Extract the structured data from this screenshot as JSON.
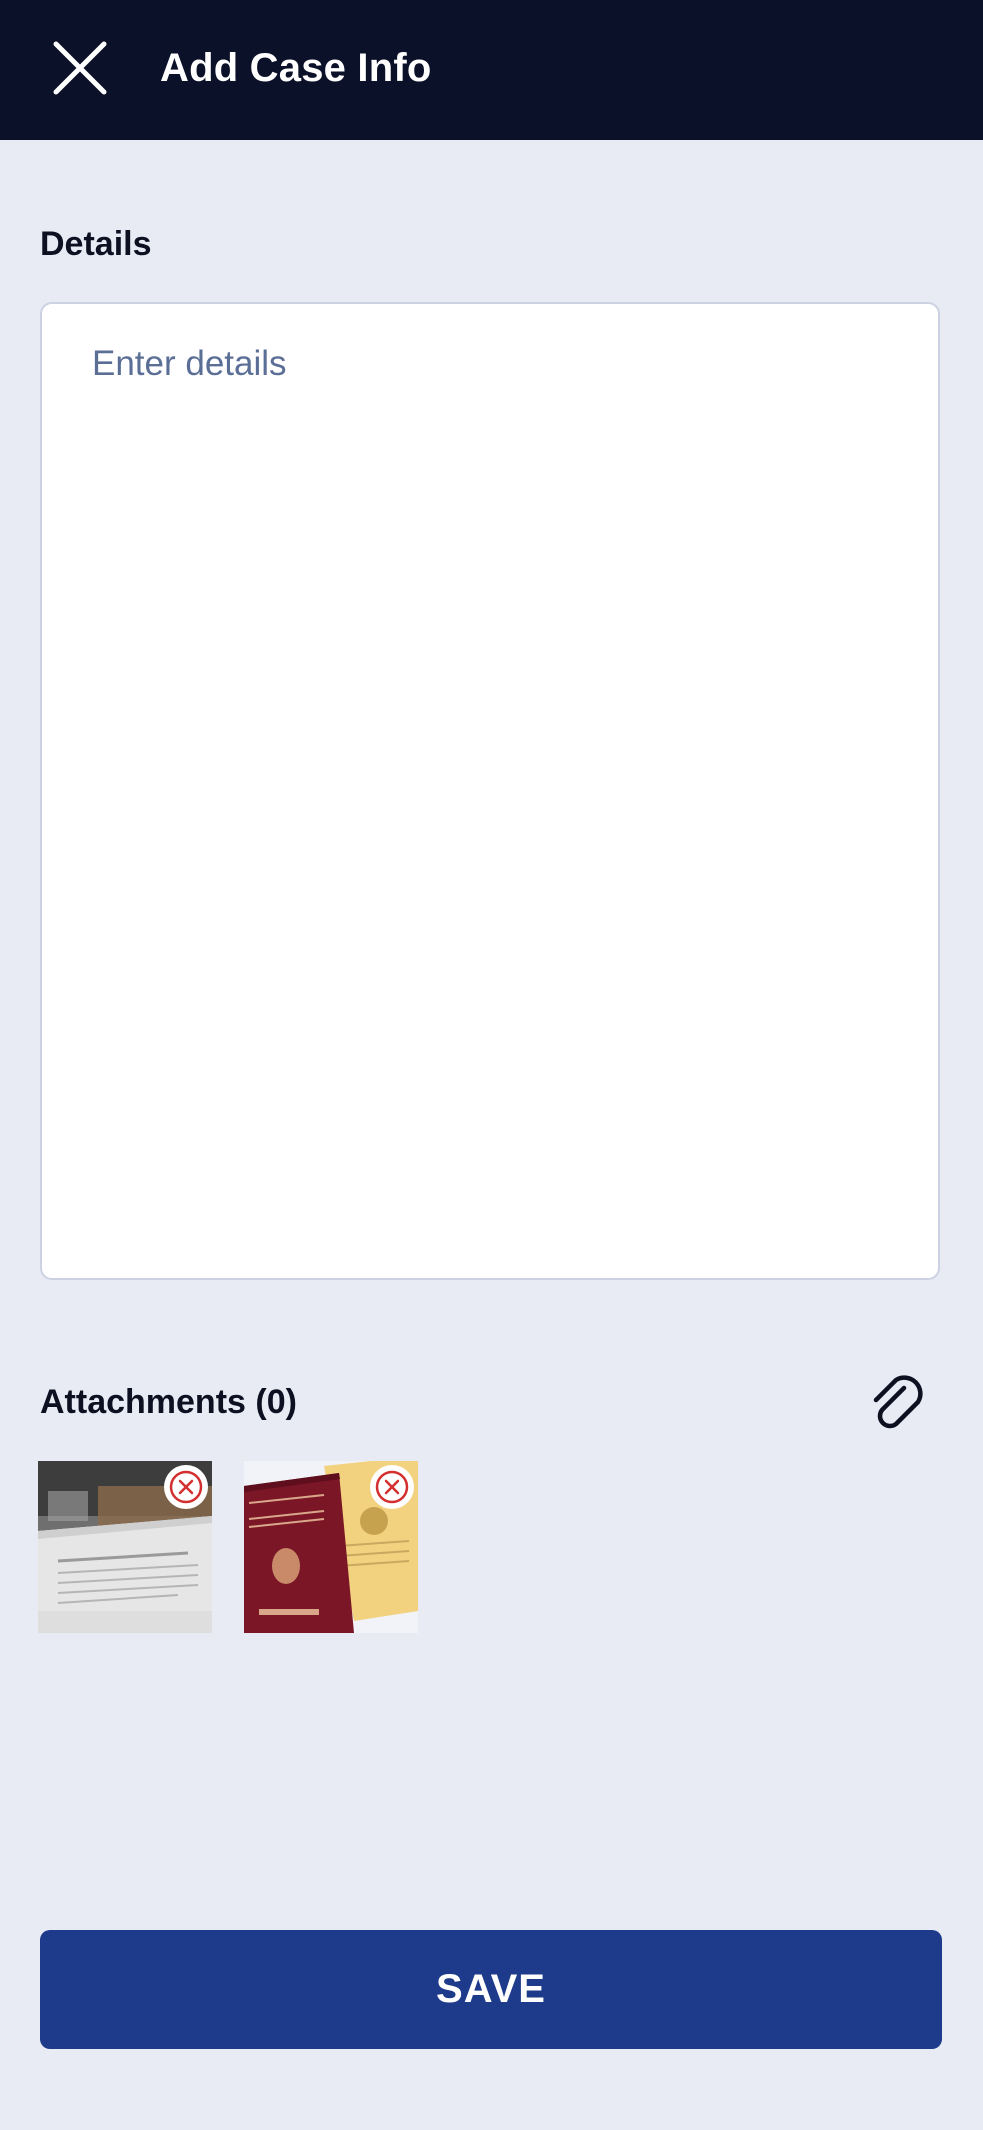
{
  "header": {
    "title": "Add Case Info",
    "close_icon": "close-icon",
    "background": "#0a1128"
  },
  "details": {
    "label": "Details",
    "value": "",
    "placeholder": "Enter details"
  },
  "attachments": {
    "label": "Attachments (0)",
    "attach_icon": "paperclip-icon",
    "items": [
      {
        "subject": "document-photo",
        "remove_icon": "remove-icon"
      },
      {
        "subject": "passport-photo",
        "remove_icon": "remove-icon"
      }
    ]
  },
  "footer": {
    "save_label": "SAVE",
    "accent": "#1e3a8a"
  },
  "colors": {
    "page_background": "#e8eaf4",
    "remove_accent": "#d32f2f"
  }
}
